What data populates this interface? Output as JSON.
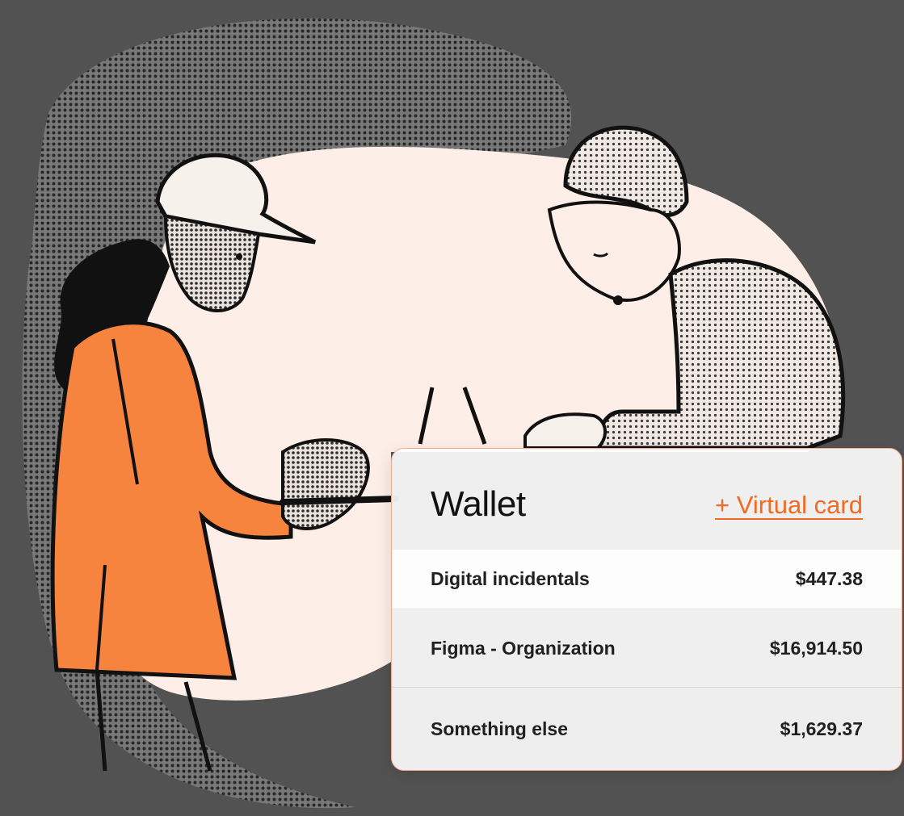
{
  "colors": {
    "background": "#525252",
    "blob": "#fdeee7",
    "accent": "#f26a21",
    "jacket": "#f6843e"
  },
  "wallet": {
    "title": "Wallet",
    "action_label": "+ Virtual card",
    "items": [
      {
        "label": "Digital incidentals",
        "amount": "$447.38"
      },
      {
        "label": "Figma - Organization",
        "amount": "$16,914.50"
      },
      {
        "label": "Something else",
        "amount": "$1,629.37"
      }
    ]
  }
}
